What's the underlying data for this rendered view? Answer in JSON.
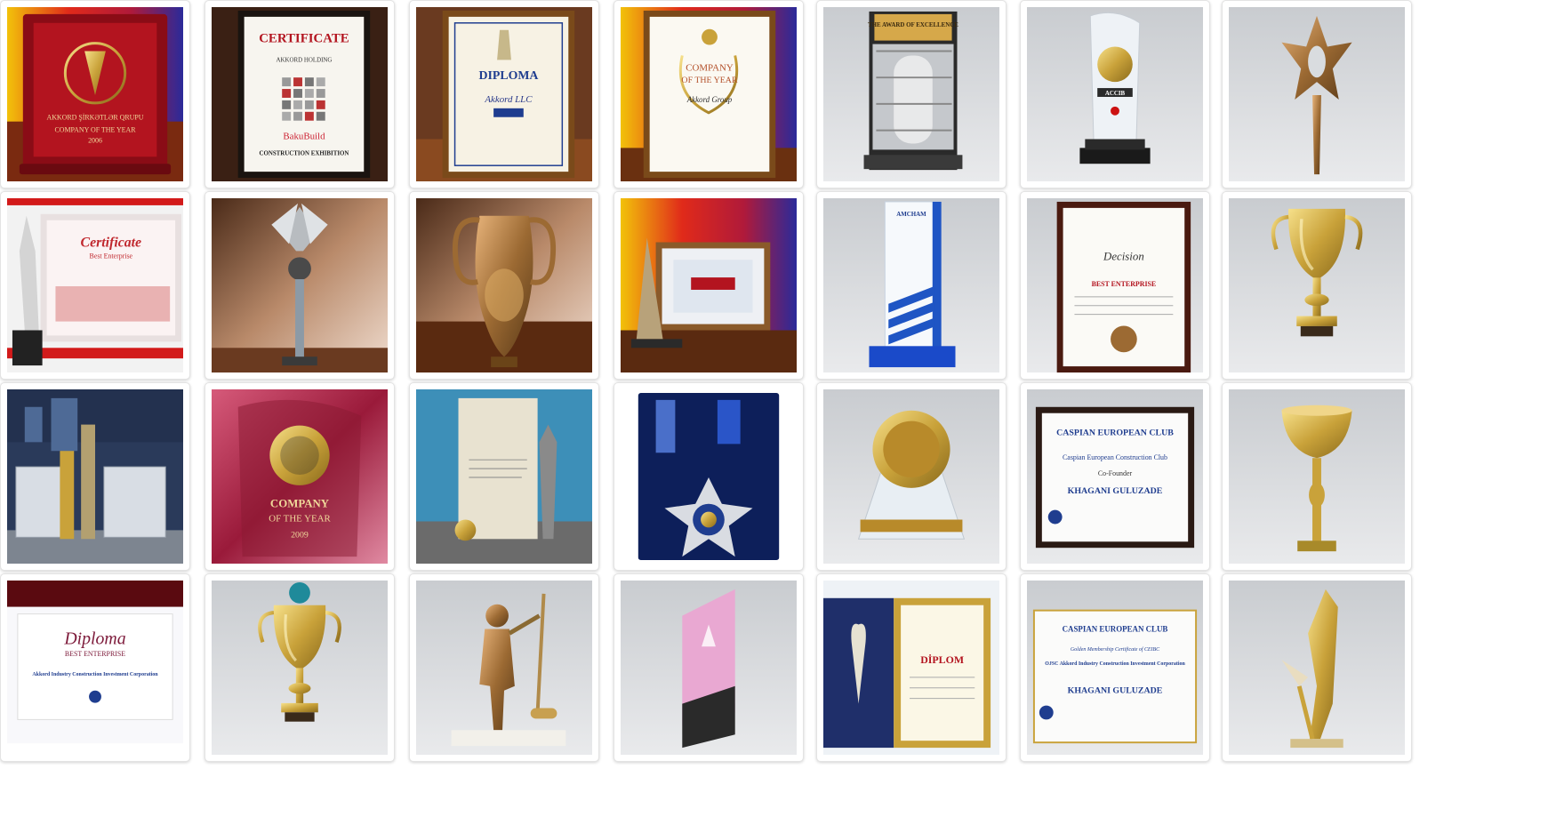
{
  "gallery": {
    "columns": 7,
    "rows": 4,
    "tiles": [
      {
        "kind": "red-award-box",
        "text": [
          "AKKORD ŞİRKƏTLƏR QRUPU",
          "COMPANY OF THE YEAR",
          "2006"
        ]
      },
      {
        "kind": "certificate-frame",
        "text": [
          "CERTIFICATE",
          "AKKORD HOLDING",
          "BakuBuild",
          "CONSTRUCTION EXHIBITION"
        ]
      },
      {
        "kind": "diploma-frame",
        "text": [
          "DIPLOMA",
          "Akkord LLC"
        ]
      },
      {
        "kind": "company-year-frame",
        "text": [
          "COMPANY",
          "OF THE YEAR",
          "Akkord Group"
        ]
      },
      {
        "kind": "chrome-trophy",
        "text": [
          "THE AWARD OF EXCELLENCE"
        ]
      },
      {
        "kind": "crystal-award",
        "text": [
          "ACCIB"
        ]
      },
      {
        "kind": "bronze-star-trophy",
        "text": []
      },
      {
        "kind": "certificate-trophy",
        "text": [
          "Certificate",
          "Best Enterprise"
        ]
      },
      {
        "kind": "winged-trophy",
        "text": []
      },
      {
        "kind": "bronze-vase",
        "text": []
      },
      {
        "kind": "framed-diploma-trophy",
        "text": []
      },
      {
        "kind": "blue-glass-award",
        "text": [
          "AMCHAM"
        ]
      },
      {
        "kind": "decision-frame",
        "text": [
          "Decision",
          "BEST ENTERPRISE"
        ]
      },
      {
        "kind": "gold-cup",
        "text": []
      },
      {
        "kind": "award-display",
        "text": []
      },
      {
        "kind": "pink-satin-award",
        "text": [
          "COMPANY",
          "OF THE",
          "YEAR",
          "2009"
        ]
      },
      {
        "kind": "plaque-statue",
        "text": []
      },
      {
        "kind": "blue-medal-box",
        "text": []
      },
      {
        "kind": "gold-medal-stand",
        "text": []
      },
      {
        "kind": "ccec-frame",
        "text": [
          "CASPIAN EUROPEAN CLUB",
          "Caspian European Construction Club",
          "Co-Founder",
          "KHAGANI GULUZADE"
        ]
      },
      {
        "kind": "gold-goblet",
        "text": []
      },
      {
        "kind": "diploma-best",
        "text": [
          "Diploma",
          "BEST ENTERPRISE",
          "Akkord Industry Construction Investment Corporation"
        ]
      },
      {
        "kind": "green-gold-cup",
        "text": []
      },
      {
        "kind": "bronze-worker",
        "text": []
      },
      {
        "kind": "pink-glass-award",
        "text": []
      },
      {
        "kind": "diplom-case",
        "text": [
          "DİPLOM"
        ]
      },
      {
        "kind": "ccec-membership",
        "text": [
          "CASPIAN EUROPEAN CLUB",
          "Golden Membership Certificate of CEIBC",
          "OJSC Akkord Industry Construction Investment Corporation",
          "KHAGANI GULUZADE"
        ]
      },
      {
        "kind": "gold-sculpture",
        "text": []
      }
    ]
  },
  "colors": {
    "page_background": "#ffffff",
    "tile_border": "#e3e3e3",
    "gold": "#c9a23a",
    "bronze": "#9c6a33",
    "deep_red": "#a0121e",
    "royal_blue": "#1f3d8f"
  }
}
